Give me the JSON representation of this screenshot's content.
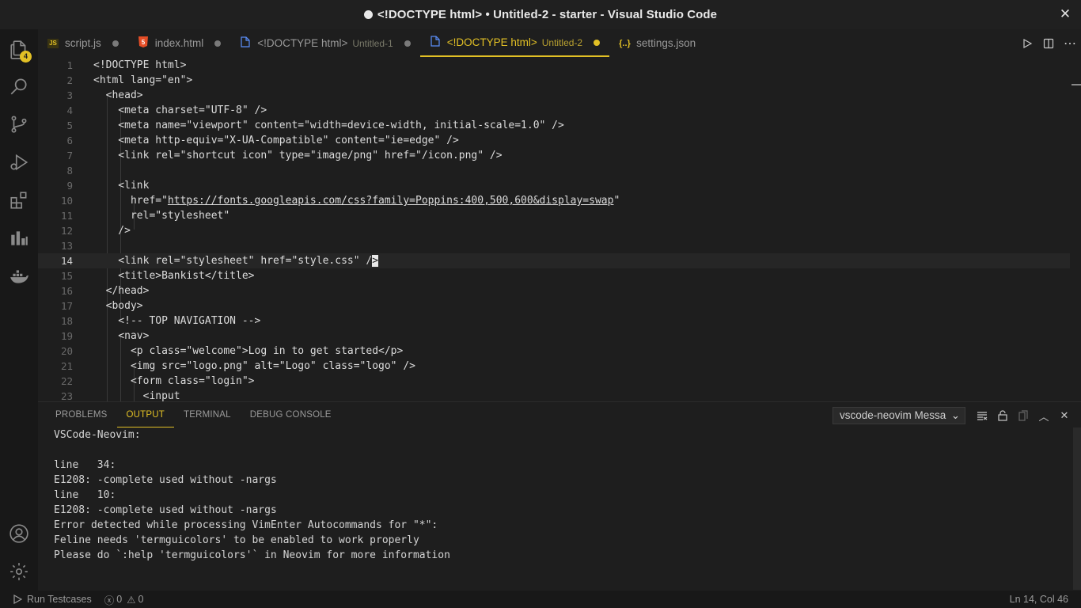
{
  "window": {
    "title": "<!DOCTYPE html> • Untitled-2 - starter - Visual Studio Code"
  },
  "activity_bar": {
    "explorer_badge": "4",
    "items": [
      "explorer-icon",
      "search-icon",
      "source-control-icon",
      "run-debug-icon",
      "extensions-icon",
      "chart-icon",
      "docker-icon"
    ],
    "bottom": [
      "account-icon",
      "settings-gear-icon"
    ]
  },
  "tabs": [
    {
      "icon": "JS",
      "label": "script.js",
      "sub": "",
      "modified": true,
      "active": false
    },
    {
      "icon": "5",
      "label": "index.html",
      "sub": "",
      "modified": true,
      "active": false
    },
    {
      "icon": "file",
      "label": "<!DOCTYPE html>",
      "sub": "Untitled-1",
      "modified": true,
      "active": false
    },
    {
      "icon": "file",
      "label": "<!DOCTYPE html>",
      "sub": "Untitled-2",
      "modified": true,
      "active": true
    },
    {
      "icon": "{..}",
      "label": "settings.json",
      "sub": "",
      "modified": false,
      "active": false
    }
  ],
  "editor": {
    "current_line": 14,
    "lines": [
      {
        "n": "1",
        "text": "<!DOCTYPE html>"
      },
      {
        "n": "2",
        "text": "<html lang=\"en\">"
      },
      {
        "n": "3",
        "text": "  <head>"
      },
      {
        "n": "4",
        "text": "    <meta charset=\"UTF-8\" />"
      },
      {
        "n": "5",
        "text": "    <meta name=\"viewport\" content=\"width=device-width, initial-scale=1.0\" />"
      },
      {
        "n": "6",
        "text": "    <meta http-equiv=\"X-UA-Compatible\" content=\"ie=edge\" />"
      },
      {
        "n": "7",
        "text": "    <link rel=\"shortcut icon\" type=\"image/png\" href=\"/icon.png\" />"
      },
      {
        "n": "8",
        "text": ""
      },
      {
        "n": "9",
        "text": "    <link"
      },
      {
        "n": "10",
        "pre": "      href=\"",
        "link": "https://fonts.googleapis.com/css?family=Poppins:400,500,600&display=swap",
        "post": "\""
      },
      {
        "n": "11",
        "text": "      rel=\"stylesheet\""
      },
      {
        "n": "12",
        "text": "    />"
      },
      {
        "n": "13",
        "text": ""
      },
      {
        "n": "14",
        "pre": "    <link rel=\"stylesheet\" href=\"style.css\" /",
        "cursor": ">",
        "post": ""
      },
      {
        "n": "15",
        "text": "    <title>Bankist</title>"
      },
      {
        "n": "16",
        "text": "  </head>"
      },
      {
        "n": "17",
        "text": "  <body>"
      },
      {
        "n": "18",
        "text": "    <!-- TOP NAVIGATION -->"
      },
      {
        "n": "19",
        "text": "    <nav>"
      },
      {
        "n": "20",
        "text": "      <p class=\"welcome\">Log in to get started</p>"
      },
      {
        "n": "21",
        "text": "      <img src=\"logo.png\" alt=\"Logo\" class=\"logo\" />"
      },
      {
        "n": "22",
        "text": "      <form class=\"login\">"
      },
      {
        "n": "23",
        "text": "        <input"
      }
    ]
  },
  "panel": {
    "tabs": [
      {
        "label": "PROBLEMS",
        "active": false
      },
      {
        "label": "OUTPUT",
        "active": true
      },
      {
        "label": "TERMINAL",
        "active": false
      },
      {
        "label": "DEBUG CONSOLE",
        "active": false
      }
    ],
    "channel_select": "vscode-neovim Messa",
    "output_lines": [
      "VSCode-Neovim:",
      "",
      "line   34:",
      "E1208: -complete used without -nargs",
      "line   10:",
      "E1208: -complete used without -nargs",
      "Error detected while processing VimEnter Autocommands for \"*\":",
      "Feline needs 'termguicolors' to be enabled to work properly",
      "Please do `:help 'termguicolors'` in Neovim for more information"
    ]
  },
  "statusbar": {
    "run_testcases": "Run Testcases",
    "errors": "0",
    "warnings": "0",
    "position": "Ln 14, Col 46"
  },
  "colors": {
    "accent": "#e2c025",
    "background": "#1e1e1e",
    "sidebar": "#181818"
  }
}
